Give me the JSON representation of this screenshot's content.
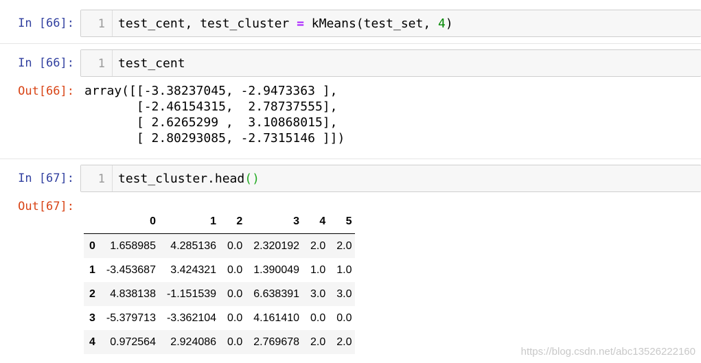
{
  "cells": [
    {
      "in_prompt": "In [66]:",
      "line_number": "1",
      "code": {
        "a": "test_cent, test_cluster ",
        "op": "=",
        "b": " kMeans(test_set, ",
        "num": "4",
        "c": ")"
      }
    },
    {
      "in_prompt": "In [66]:",
      "line_number": "1",
      "code": {
        "a": "test_cent"
      },
      "out_prompt": "Out[66]:",
      "output": "array([[-3.38237045, -2.9473363 ],\n       [-2.46154315,  2.78737555],\n       [ 2.6265299 ,  3.10868015],\n       [ 2.80293085, -2.7315146 ]])"
    },
    {
      "in_prompt": "In [67]:",
      "line_number": "1",
      "code": {
        "a": "test_cluster.head",
        "paren": "()"
      },
      "out_prompt": "Out[67]:",
      "dataframe": {
        "columns": [
          "0",
          "1",
          "2",
          "3",
          "4",
          "5"
        ],
        "rows": [
          {
            "index": "0",
            "values": [
              "1.658985",
              "4.285136",
              "0.0",
              "2.320192",
              "2.0",
              "2.0"
            ]
          },
          {
            "index": "1",
            "values": [
              "-3.453687",
              "3.424321",
              "0.0",
              "1.390049",
              "1.0",
              "1.0"
            ]
          },
          {
            "index": "2",
            "values": [
              "4.838138",
              "-1.151539",
              "0.0",
              "6.638391",
              "3.0",
              "3.0"
            ]
          },
          {
            "index": "3",
            "values": [
              "-5.379713",
              "-3.362104",
              "0.0",
              "4.161410",
              "0.0",
              "0.0"
            ]
          },
          {
            "index": "4",
            "values": [
              "0.972564",
              "2.924086",
              "0.0",
              "2.769678",
              "2.0",
              "2.0"
            ]
          }
        ]
      }
    }
  ],
  "watermark": "https://blog.csdn.net/abc13526222160"
}
